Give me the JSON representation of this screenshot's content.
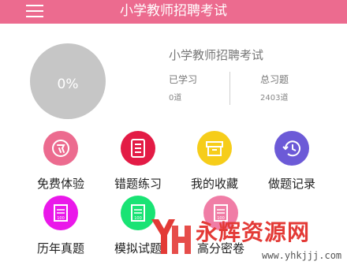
{
  "header": {
    "title": "小学教师招聘考试",
    "menu_icon": "menu-icon",
    "color": "#ec6b8f"
  },
  "progress": {
    "percent_label": "0%",
    "value": 0
  },
  "subject": "小学教师招聘考试",
  "stats": [
    {
      "label": "已学习",
      "value": "0道"
    },
    {
      "label": "总习题",
      "value": "2403道"
    }
  ],
  "features": [
    {
      "label": "免费体验",
      "icon": "free-badge-icon",
      "color": "#ec6b8f"
    },
    {
      "label": "错题练习",
      "icon": "notebook-icon",
      "color": "#e31b45"
    },
    {
      "label": "我的收藏",
      "icon": "box-icon",
      "color": "#f6cd1a"
    },
    {
      "label": "做题记录",
      "icon": "history-clock-icon",
      "color": "#6c5ad7"
    },
    {
      "label": "历年真题",
      "icon": "paper-100-icon",
      "color": "#ea18ea"
    },
    {
      "label": "模拟试题",
      "icon": "paper-100-icon",
      "color": "#19e374"
    },
    {
      "label": "高分密卷",
      "icon": "paper-100-icon",
      "color": "#f07da6"
    }
  ],
  "watermark": {
    "title": "永辉资源网",
    "url": "www.yhkjjj.com",
    "logo_icon": "yh-logo-icon"
  }
}
